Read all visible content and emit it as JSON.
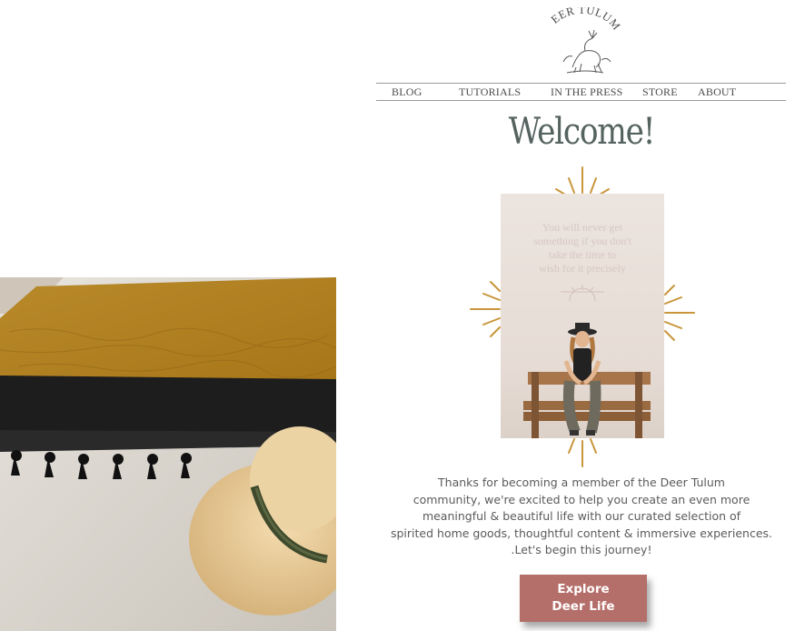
{
  "brand": {
    "name": "DEER TULUM"
  },
  "nav": {
    "items": [
      {
        "label": "BLOG"
      },
      {
        "label": "TUTORIALS"
      },
      {
        "label": "IN THE PRESS"
      },
      {
        "label": "STORE"
      },
      {
        "label": "ABOUT"
      }
    ]
  },
  "hero": {
    "title": "Welcome!",
    "quote": "You will never get\nsomething if you don't\ntake the time to\nwish for it precisely"
  },
  "intro": {
    "text": "Thanks for becoming a member of the  Deer Tulum\ncommunity, we're excited to help you create an even more\nmeaningful & beautiful life  with our curated selection of\nspirited home goods, thoughtful content & immersive experiences.\n.Let's begin this journey!"
  },
  "cta": {
    "label": "Explore\nDeer Life"
  },
  "colors": {
    "title": "#556360",
    "accent_gold": "#c9963c",
    "cta_background": "#b56f6a",
    "nav_text": "#4a4a4a"
  }
}
